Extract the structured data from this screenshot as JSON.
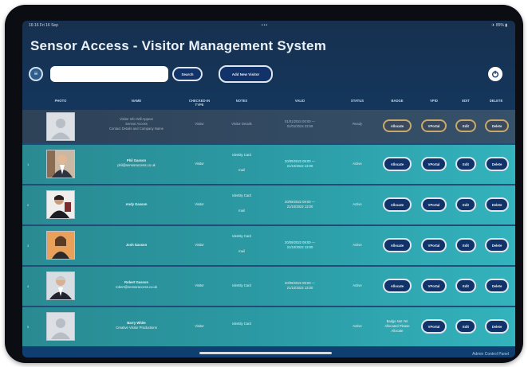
{
  "status_bar": {
    "time": "16:16  Fri 16 Sep",
    "dots": "•••",
    "battery": "✈ 85% ▮"
  },
  "title": "Sensor Access - Visitor Management System",
  "toolbar": {
    "menu_icon": "menu-icon",
    "search_placeholder": "",
    "search_label": "Search",
    "add_label": "Add New Visitor",
    "power_icon": "power-icon"
  },
  "table": {
    "headers": [
      "PHOTO",
      "NAME",
      "CHECKED-IN TYPE",
      "NOTES",
      "VALID",
      "STATUS",
      "BADGE",
      "VPID",
      "EDIT",
      "DELETE"
    ],
    "rows": [
      {
        "idx": "",
        "name": "Visitor Info Will Appear",
        "sub1": "Sensor Access",
        "sub2": "Contact Details and Company Name",
        "type": "Visitor",
        "notes": "Visitor Details",
        "valid": "01/01/2024 00:00 —",
        "valid2": "01/01/2024 23:59",
        "status": "Ready",
        "badge": "Allocate",
        "vpid": "VPortal",
        "edit": "Edit",
        "delete": "Delete",
        "photo": "placeholder"
      },
      {
        "idx": "1",
        "name": "Phil Gasson",
        "sub1": "phil@sensoraccess.co.uk",
        "sub2": "",
        "type": "Visitor",
        "notes": "Identity Card",
        "notes2": "mail",
        "valid": "20/09/2022 09:00 —",
        "valid2": "21/10/2022 13:00",
        "status": "Active",
        "badge": "Allocate",
        "vpid": "VPortal",
        "edit": "Edit",
        "delete": "Delete",
        "photo": "man-suit"
      },
      {
        "idx": "2",
        "name": "Andy Gasson",
        "sub1": "",
        "sub2": "",
        "type": "Visitor",
        "notes": "Identity Card",
        "notes2": "mail",
        "valid": "20/09/2022 09:00 —",
        "valid2": "21/10/2022 13:00",
        "status": "Active",
        "badge": "Allocate",
        "vpid": "VPortal",
        "edit": "Edit",
        "delete": "Delete",
        "photo": "man-dark"
      },
      {
        "idx": "3",
        "name": "Josh Gasson",
        "sub1": "",
        "sub2": "",
        "type": "Visitor",
        "notes": "Identity Card",
        "notes2": "mail",
        "valid": "20/09/2022 09:00 —",
        "valid2": "21/10/2022 13:00",
        "status": "Active",
        "badge": "Allocate",
        "vpid": "VPortal",
        "edit": "Edit",
        "delete": "Delete",
        "photo": "woman-orange"
      },
      {
        "idx": "4",
        "name": "Robert Gasson",
        "sub1": "robert@sensoraccess.co.uk",
        "sub2": "",
        "type": "Visitor",
        "notes": "Identity Card",
        "notes2": "",
        "valid": "20/09/2022 09:00 —",
        "valid2": "21/10/2022 13:00",
        "status": "Active",
        "badge": "Allocate",
        "vpid": "VPortal",
        "edit": "Edit",
        "delete": "Delete",
        "photo": "man-grey"
      },
      {
        "idx": "5",
        "name": "Barry White",
        "sub1": "Creative Visitor Productions",
        "sub2": "",
        "type": "Visitor",
        "notes": "Identity Card",
        "notes2": "",
        "valid": "",
        "valid2": "",
        "status": "Active",
        "badge_text1": "Badge Not Yet",
        "badge_text2": "Allocated Please",
        "badge_text3": "Allocate",
        "vpid": "VPortal",
        "edit": "Edit",
        "delete": "Delete",
        "photo": "placeholder"
      }
    ]
  },
  "footer": {
    "admin_link": "Admin Control Panel"
  },
  "colors": {
    "accent": "#12336a",
    "row_teal": "#2b9aa4",
    "header_bg": "#17304f"
  }
}
